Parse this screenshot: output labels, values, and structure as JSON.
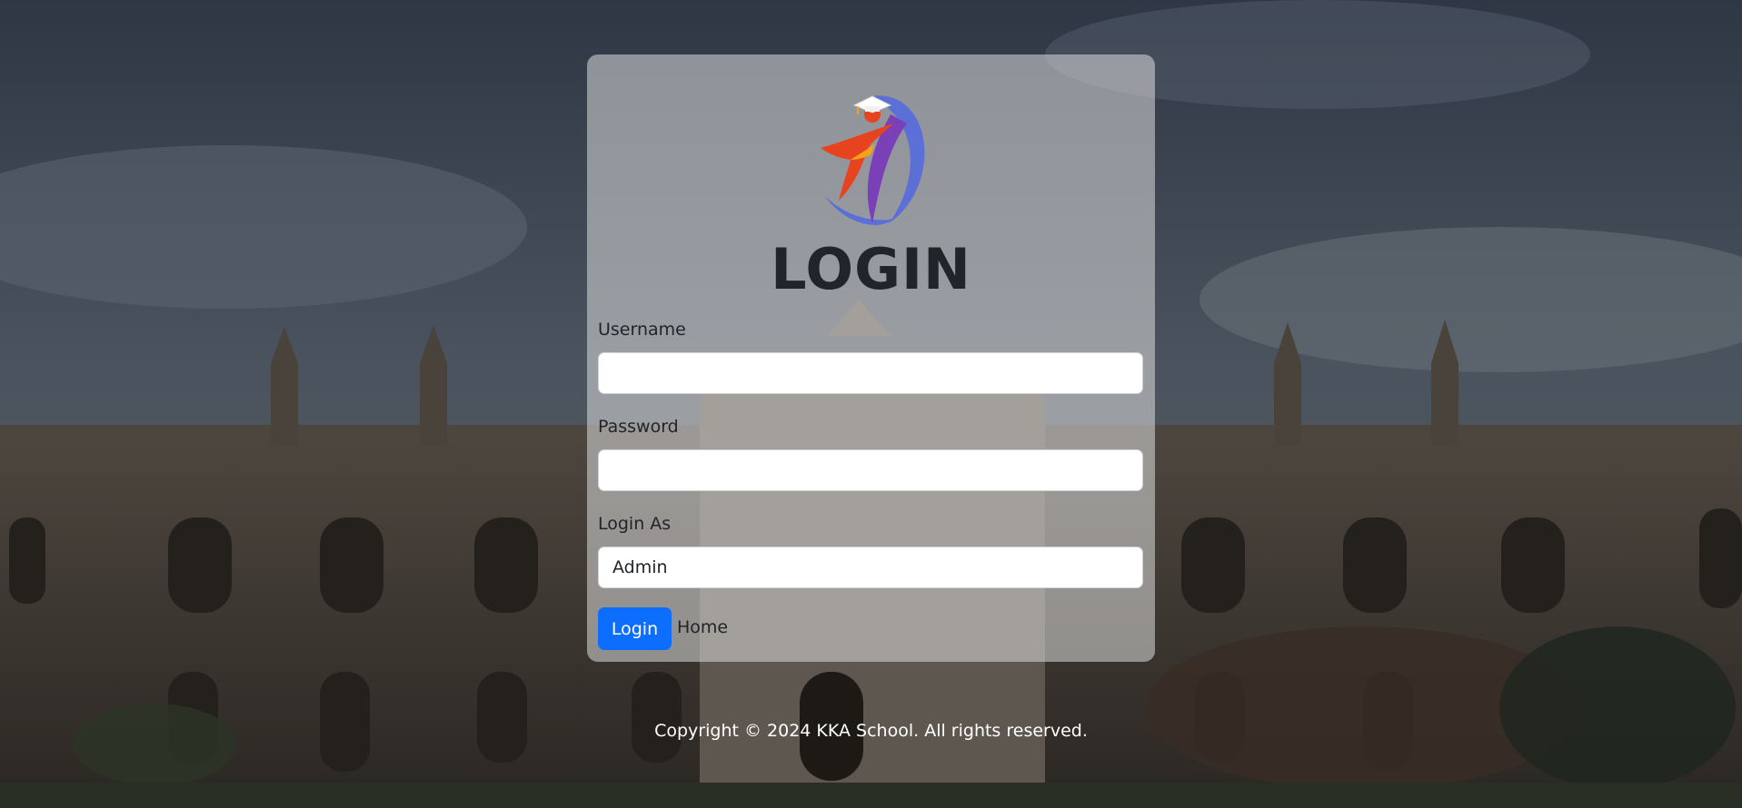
{
  "login_card": {
    "title": "LOGIN",
    "username": {
      "label": "Username",
      "value": "",
      "placeholder": ""
    },
    "password": {
      "label": "Password",
      "value": "",
      "placeholder": ""
    },
    "login_as": {
      "label": "Login As",
      "selected": "Admin"
    },
    "login_button": "Login",
    "home_link": "Home",
    "logo_icon": "school-graduate-logo-icon"
  },
  "footer": {
    "text": "Copyright © 2024 KKA School. All rights reserved."
  },
  "colors": {
    "primary": "#0d6efd",
    "title": "#212429",
    "logo_red": "#e8431f",
    "logo_orange": "#f4a21a",
    "logo_blue": "#5c6fd6",
    "logo_purple": "#7b3fb8"
  }
}
